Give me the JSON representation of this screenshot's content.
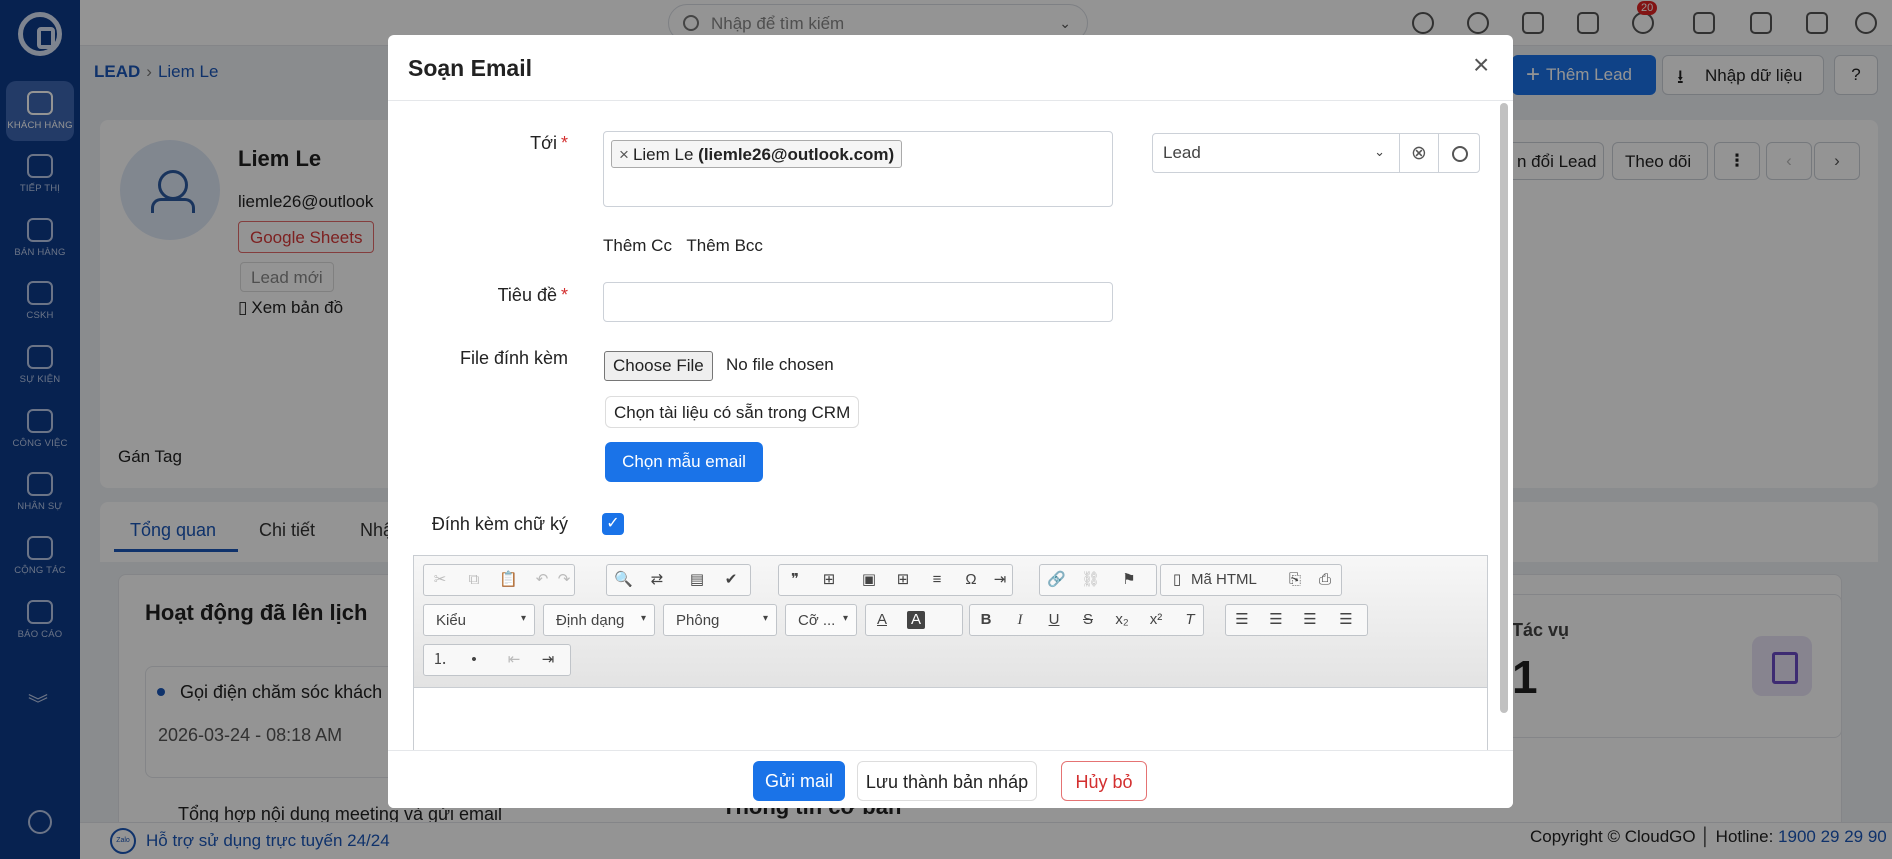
{
  "sidebar": {
    "items": [
      {
        "label": "KHÁCH HÀNG",
        "icon": "customers-icon"
      },
      {
        "label": "TIẾP THỊ",
        "icon": "megaphone-icon"
      },
      {
        "label": "BÁN HÀNG",
        "icon": "cart-icon"
      },
      {
        "label": "CSKH",
        "icon": "lifebuoy-icon"
      },
      {
        "label": "SỰ KIỆN",
        "icon": "calendar-icon"
      },
      {
        "label": "CÔNG VIỆC",
        "icon": "briefcase-icon"
      },
      {
        "label": "NHÂN SỰ",
        "icon": "person-icon"
      },
      {
        "label": "CỘNG TÁC",
        "icon": "org-chart-icon"
      },
      {
        "label": "BÁO CÁO",
        "icon": "report-icon"
      }
    ]
  },
  "topbar": {
    "search_placeholder": "Nhập để tìm kiếm",
    "notification_count": "20"
  },
  "breadcrumb": {
    "root": "LEAD",
    "current": "Liem Le"
  },
  "header_actions": {
    "add_lead": "Thêm Lead",
    "import": "Nhập dữ liệu",
    "help": "?"
  },
  "profile": {
    "name": "Liem Le",
    "email": "liemle26@outlook",
    "source_tag": "Google Sheets",
    "status": "Lead mới",
    "map_link": "Xem bản đồ",
    "assign_tag": "Gán Tag",
    "convert_label": "n đổi Lead",
    "follow_label": "Theo dõi",
    "more_label": "⋮",
    "prev_label": "‹",
    "next_label": "›"
  },
  "tabs": [
    "Tổng quan",
    "Chi tiết",
    "Nhậ"
  ],
  "schedule": {
    "title": "Hoạt động đã lên lịch",
    "item1": "Gọi điện chăm sóc khách",
    "item1_date": "2026-03-24 - 08:18 AM",
    "item2": "Tổng hợp nội dung meeting và gửi email"
  },
  "tasks": {
    "label": "Tác vụ",
    "value": "1"
  },
  "info_title": "Thông tin cơ bản",
  "footer": {
    "support": "Hỗ trợ sử dụng trực tuyến 24/24",
    "zalo": "Zalo",
    "copyright": "Copyright © CloudGO",
    "hotline_label": "Hotline:",
    "hotline": "1900 29 29 90"
  },
  "modal": {
    "title": "Soạn Email",
    "close": "×",
    "to_label": "Tới",
    "recipient_name": "Liem Le",
    "recipient_email": "(liemle26@outlook.com)",
    "recipient_remove": "×",
    "module_select": "Lead",
    "add_cc": "Thêm Cc",
    "add_bcc": "Thêm Bcc",
    "subject_label": "Tiêu đề",
    "subject_value": "",
    "attachment_label": "File đính kèm",
    "choose_file": "Choose File",
    "no_file": "No file chosen",
    "crm_docs": "Chọn tài liệu có sẵn trong CRM",
    "choose_template": "Chọn mẫu email",
    "signature_label": "Đính kèm chữ ký",
    "signature_checked": true,
    "required_mark": "*",
    "editor": {
      "style_combo": "Kiểu",
      "format_combo": "Định dạng",
      "font_combo": "Phông",
      "size_combo": "Cỡ ...",
      "html_button": "Mã HTML"
    },
    "send": "Gửi mail",
    "save_draft": "Lưu thành bản nháp",
    "cancel": "Hủy bỏ"
  },
  "colors": {
    "primary": "#1a73e8",
    "sidebar": "#0d3b8a",
    "danger": "#d32f2f"
  }
}
